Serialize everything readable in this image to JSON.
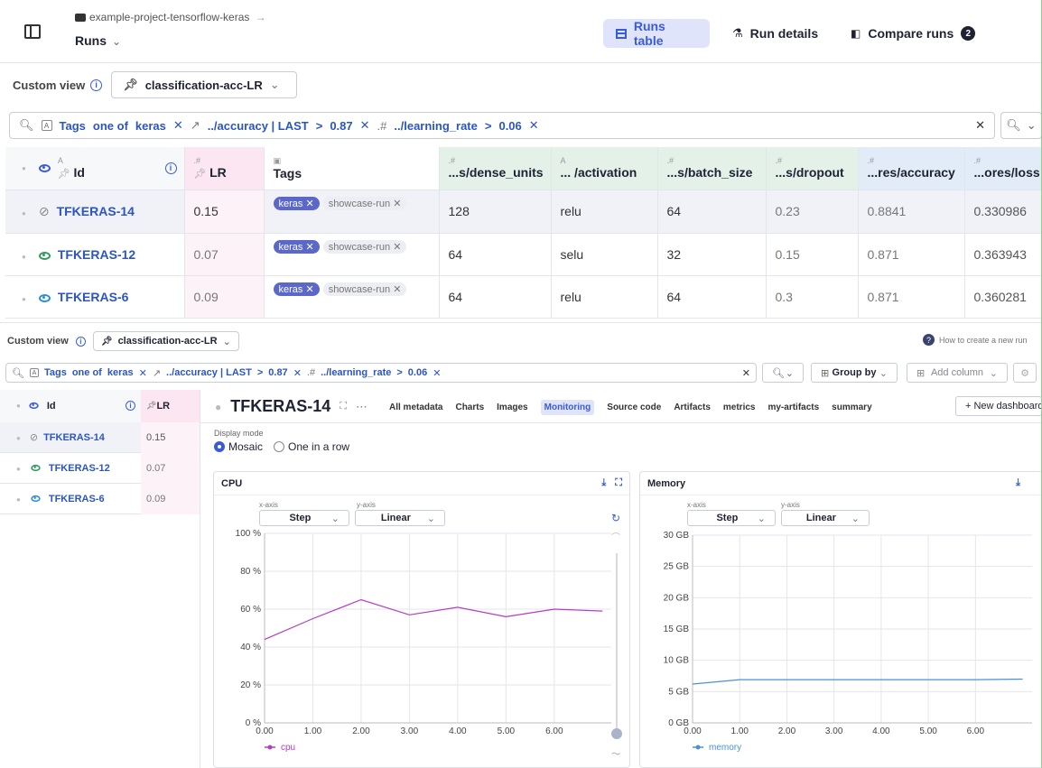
{
  "header": {
    "project": "example-project-tensorflow-keras",
    "project_arrow": "→",
    "page_title": "Runs",
    "tabs": [
      {
        "label": "Runs table",
        "active": true
      },
      {
        "label": "Run details",
        "active": false
      },
      {
        "label": "Compare runs",
        "active": false,
        "badge": "2"
      }
    ]
  },
  "view": {
    "label": "Custom view",
    "selected": "classification-acc-LR"
  },
  "filter": {
    "tags_label": "Tags",
    "tags_op": "one of",
    "tags_value": "keras",
    "f2_field": "../accuracy | LAST",
    "f2_op": ">",
    "f2_value": "0.87",
    "f3_field": "../learning_rate",
    "f3_op": ">",
    "f3_value": "0.06"
  },
  "table": {
    "columns": [
      "Id",
      "LR",
      "Tags",
      "...s/dense_units",
      "... /activation",
      "...s/batch_size",
      "...s/dropout",
      "...res/accuracy",
      "...ores/loss"
    ],
    "rows": [
      {
        "id": "TFKERAS-14",
        "lr": "0.15",
        "tags": [
          "keras",
          "showcase-run"
        ],
        "dense": "128",
        "act": "relu",
        "batch": "64",
        "dropout": "0.23",
        "acc": "0.8841",
        "loss": "0.330986"
      },
      {
        "id": "TFKERAS-12",
        "lr": "0.07",
        "tags": [
          "keras",
          "showcase-run"
        ],
        "dense": "64",
        "act": "selu",
        "batch": "32",
        "dropout": "0.15",
        "acc": "0.871",
        "loss": "0.363943"
      },
      {
        "id": "TFKERAS-6",
        "lr": "0.09",
        "tags": [
          "keras",
          "showcase-run"
        ],
        "dense": "64",
        "act": "relu",
        "batch": "64",
        "dropout": "0.3",
        "acc": "0.871",
        "loss": "0.360281"
      }
    ]
  },
  "lower": {
    "how_to": "How to create a new run",
    "group_by": "Group by",
    "add_column": "Add column",
    "run_title": "TFKERAS-14",
    "tabs": [
      "All metadata",
      "Charts",
      "Images",
      "Monitoring",
      "Source code",
      "Artifacts",
      "metrics",
      "my-artifacts",
      "summary"
    ],
    "active_tab": "Monitoring",
    "new_dashboard": "+ New dashboard",
    "display_mode_label": "Display mode",
    "mode_mosaic": "Mosaic",
    "mode_row": "One in a row",
    "xaxis_label": "x-axis",
    "yaxis_label": "y-axis",
    "xaxis_value": "Step",
    "yaxis_value": "Linear"
  },
  "chart_data": [
    {
      "type": "line",
      "title": "CPU",
      "x": [
        0,
        1,
        2,
        3,
        4,
        5,
        6,
        7
      ],
      "series": [
        {
          "name": "cpu",
          "values": [
            44,
            55,
            65,
            57,
            61,
            56,
            60,
            59
          ]
        }
      ],
      "xticks": [
        "0.00",
        "1.00",
        "2.00",
        "3.00",
        "4.00",
        "5.00",
        "6.00"
      ],
      "yticks": [
        "0 %",
        "20 %",
        "40 %",
        "60 %",
        "80 %",
        "100 %"
      ],
      "xlim": [
        0,
        7.2
      ],
      "ylim": [
        0,
        100
      ],
      "color": "#b43cc4"
    },
    {
      "type": "line",
      "title": "Memory",
      "x": [
        0,
        1,
        2,
        3,
        4,
        5,
        6,
        7
      ],
      "series": [
        {
          "name": "memory",
          "values": [
            6.2,
            6.9,
            6.9,
            6.9,
            6.9,
            6.9,
            6.9,
            7.0
          ]
        }
      ],
      "xticks": [
        "0.00",
        "1.00",
        "2.00",
        "3.00",
        "4.00",
        "5.00",
        "6.00"
      ],
      "yticks": [
        "0 GB",
        "5 GB",
        "10 GB",
        "15 GB",
        "20 GB",
        "25 GB",
        "30 GB"
      ],
      "xlim": [
        0,
        7.2
      ],
      "ylim": [
        0,
        30
      ],
      "color": "#4a90d9"
    }
  ]
}
